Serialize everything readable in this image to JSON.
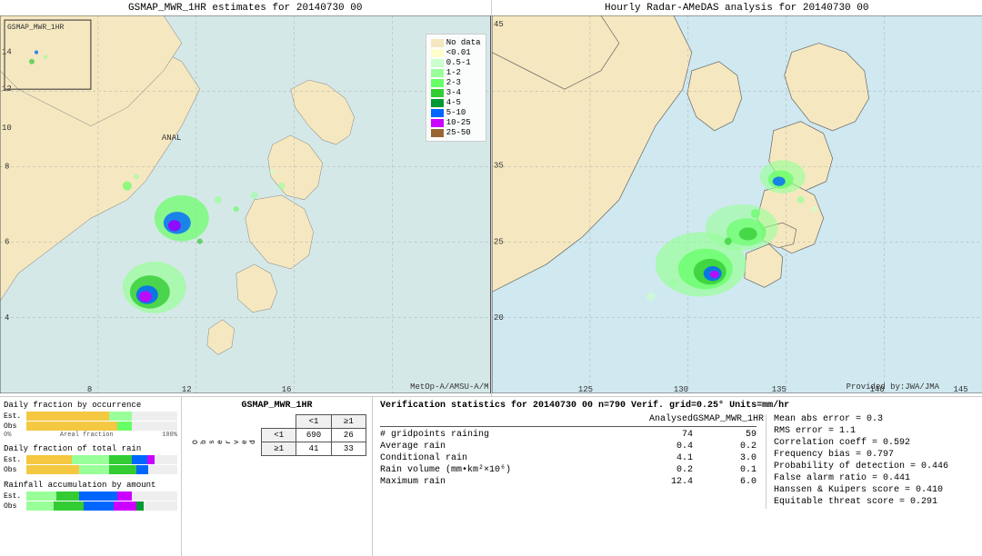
{
  "left_map": {
    "title": "GSMAP_MWR_1HR estimates for 20140730 00",
    "watermark": "MetOp-A/AMSU-A/M"
  },
  "right_map": {
    "title": "Hourly Radar-AMeDAS analysis for 20140730 00",
    "watermark": "Provided by:JWA/JMA"
  },
  "legend": {
    "items": [
      {
        "label": "No data",
        "color": "#f5f0dc"
      },
      {
        "label": "<0.01",
        "color": "#ffffcc"
      },
      {
        "label": "0.5-1",
        "color": "#ccffcc"
      },
      {
        "label": "1-2",
        "color": "#99ff99"
      },
      {
        "label": "2-3",
        "color": "#66ff66"
      },
      {
        "label": "3-4",
        "color": "#33cc33"
      },
      {
        "label": "4-5",
        "color": "#009933"
      },
      {
        "label": "5-10",
        "color": "#0066ff"
      },
      {
        "label": "10-25",
        "color": "#cc00ff"
      },
      {
        "label": "25-50",
        "color": "#996633"
      }
    ]
  },
  "charts": {
    "title1": "Daily fraction by occurrence",
    "title2": "Daily fraction of total rain",
    "title3": "Rainfall accumulation by amount",
    "est_label": "Est.",
    "obs_label": "Obs",
    "pct_0": "0%",
    "pct_100": "100%",
    "areal_fraction": "Areal fraction"
  },
  "contingency": {
    "title": "GSMAP_MWR_1HR",
    "col_lt1": "<1",
    "col_ge1": "≥1",
    "row_lt1": "<1",
    "row_ge1": "≥1",
    "observed_label": "O\nb\ns\ne\nr\nv\ne\nd",
    "v690": "690",
    "v26": "26",
    "v41": "41",
    "v33": "33"
  },
  "verification": {
    "title": "Verification statistics for 20140730 00  n=790  Verif. grid=0.25°  Units=mm/hr",
    "col_analysed": "Analysed",
    "col_gsmap": "GSMAP_MWR_1HR",
    "rows": [
      {
        "name": "# gridpoints raining",
        "val1": "74",
        "val2": "59"
      },
      {
        "name": "Average rain",
        "val1": "0.4",
        "val2": "0.2"
      },
      {
        "name": "Conditional rain",
        "val1": "4.1",
        "val2": "3.0"
      },
      {
        "name": "Rain volume (mm•km²×10⁶)",
        "val1": "0.2",
        "val2": "0.1"
      },
      {
        "name": "Maximum rain",
        "val1": "12.4",
        "val2": "6.0"
      }
    ],
    "stats_right": [
      {
        "label": "Mean abs error = 0.3"
      },
      {
        "label": "RMS error = 1.1"
      },
      {
        "label": "Correlation coeff = 0.592"
      },
      {
        "label": "Frequency bias = 0.797"
      },
      {
        "label": "Probability of detection = 0.446"
      },
      {
        "label": "False alarm ratio = 0.441"
      },
      {
        "label": "Hanssen & Kuipers score = 0.410"
      },
      {
        "label": "Equitable threat score = 0.291"
      }
    ]
  }
}
